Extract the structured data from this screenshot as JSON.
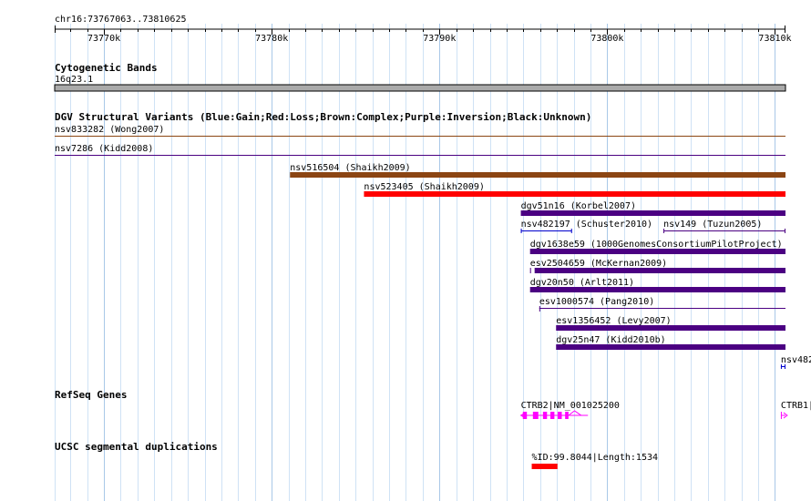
{
  "region": {
    "label": "chr16:73767063..73810625",
    "start": 73767063,
    "end": 73810625,
    "ticks": [
      {
        "pos": 73770000,
        "label": "73770k"
      },
      {
        "pos": 73780000,
        "label": "73780k"
      },
      {
        "pos": 73790000,
        "label": "73790k"
      },
      {
        "pos": 73800000,
        "label": "73800k"
      },
      {
        "pos": 73810000,
        "label": "73810k"
      }
    ]
  },
  "tracks": {
    "cytoband": {
      "title": "Cytogenetic Bands",
      "band_label": "16q23.1",
      "color": "#aaaaaa"
    },
    "dgv": {
      "title": "DGV Structural Variants (Blue:Gain;Red:Loss;Brown:Complex;Purple:Inversion;Black:Unknown)",
      "colors": {
        "brown": "#8b4513",
        "red": "#ff0000",
        "purple": "#4b0082",
        "blue": "#0000cc"
      },
      "features": [
        {
          "label": "nsv833282 (Wong2007)",
          "start": 73767063,
          "end": 73810625,
          "style": "line",
          "color": "brown"
        },
        {
          "label": "nsv7286 (Kidd2008)",
          "start": 73767063,
          "end": 73810625,
          "style": "line",
          "color": "purple"
        },
        {
          "label": "nsv516504 (Shaikh2009)",
          "start": 73781090,
          "end": 73810625,
          "style": "bar",
          "color": "brown"
        },
        {
          "label": "nsv523405 (Shaikh2009)",
          "start": 73785500,
          "end": 73810625,
          "style": "bar",
          "color": "red"
        },
        {
          "label": "dgv51n16 (Korbel2007)",
          "start": 73794850,
          "end": 73810625,
          "style": "bar",
          "color": "purple"
        },
        {
          "label": "nsv482197 (Schuster2010)",
          "start": 73794850,
          "end": 73797900,
          "style": "span",
          "color": "blue"
        },
        {
          "label": "nsv149 (Tuzun2005)",
          "start": 73803350,
          "end": 73810625,
          "style": "span",
          "color": "purple"
        },
        {
          "label": "dgv1638e59 (1000GenomesConsortiumPilotProject)",
          "start": 73795400,
          "end": 73810625,
          "style": "bar",
          "color": "purple"
        },
        {
          "label": "esv2504659 (McKernan2009)",
          "start": 73795400,
          "end": 73810625,
          "style": "bar-tick",
          "color": "purple"
        },
        {
          "label": "dgv20n50 (Arlt2011)",
          "start": 73795400,
          "end": 73810625,
          "style": "bar",
          "color": "purple"
        },
        {
          "label": "esv1000574 (Pang2010)",
          "start": 73795950,
          "end": 73810625,
          "style": "line-tick",
          "color": "purple"
        },
        {
          "label": "esv1356452 (Levy2007)",
          "start": 73796950,
          "end": 73810625,
          "style": "bar",
          "color": "purple"
        },
        {
          "label": "dgv25n47 (Kidd2010b)",
          "start": 73796950,
          "end": 73810625,
          "style": "bar",
          "color": "purple"
        },
        {
          "label": "nsv482",
          "start": 73810350,
          "end": 73810625,
          "style": "span",
          "color": "blue"
        }
      ]
    },
    "refseq": {
      "title": "RefSeq Genes",
      "color": "#ff00ff",
      "genes": [
        {
          "label": "CTRB2|NM_001025200",
          "start": 73794850,
          "end": 73798850
        },
        {
          "label": "CTRB1|",
          "start": 73810350,
          "end": 73810625
        }
      ]
    },
    "segdup": {
      "title": "UCSC segmental duplications",
      "color": "#ff0000",
      "features": [
        {
          "label": "%ID:99.8044|Length:1534",
          "start": 73795500,
          "end": 73797034
        }
      ]
    }
  }
}
